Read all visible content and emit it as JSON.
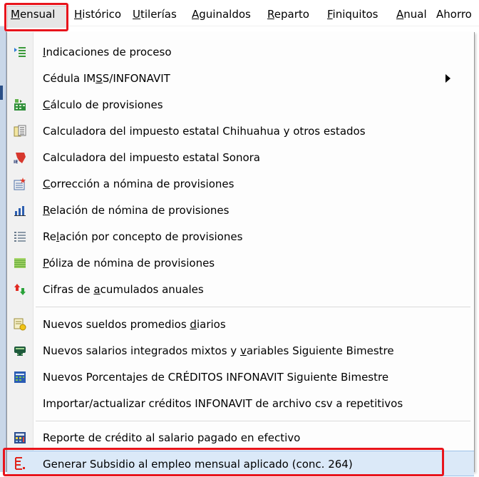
{
  "menubar": {
    "items": [
      {
        "pre": "",
        "u": "M",
        "post": "ensual"
      },
      {
        "pre": "",
        "u": "H",
        "post": "istórico"
      },
      {
        "pre": "",
        "u": "U",
        "post": "tilerías"
      },
      {
        "pre": "",
        "u": "A",
        "post": "guinaldos"
      },
      {
        "pre": "",
        "u": "R",
        "post": "eparto"
      },
      {
        "pre": "",
        "u": "F",
        "post": "iniquitos"
      },
      {
        "pre": "",
        "u": "A",
        "post": "nual"
      },
      {
        "pre": "Ahorro",
        "u": "",
        "post": ""
      }
    ]
  },
  "dropdown": {
    "items": [
      {
        "pre": "",
        "u": "I",
        "post": "ndicaciones de proceso",
        "icon": "process-indications-icon"
      },
      {
        "pre": "Cédula IM",
        "u": "S",
        "post": "S/INFONAVIT",
        "icon": "",
        "submenu": true
      },
      {
        "pre": "",
        "u": "C",
        "post": "álculo de provisiones",
        "icon": "calculate-provisions-icon"
      },
      {
        "pre": "Calculadora del impuesto estatal Chihuahua y otros estados",
        "u": "",
        "post": "",
        "icon": "state-tax-calculator-icon"
      },
      {
        "pre": "Calculadora del impuesto estatal Sonora",
        "u": "",
        "post": "",
        "icon": "sonora-tax-icon"
      },
      {
        "pre": "",
        "u": "C",
        "post": "orrección a nómina de provisiones",
        "icon": "payroll-correction-icon"
      },
      {
        "pre": "",
        "u": "R",
        "post": "elación de nómina de provisiones",
        "icon": "bar-chart-icon"
      },
      {
        "pre": "Re",
        "u": "l",
        "post": "ación por concepto de provisiones",
        "icon": "list-icon"
      },
      {
        "pre": "",
        "u": "P",
        "post": "óliza de nómina de provisiones",
        "icon": "policy-icon"
      },
      {
        "pre": "Cifras de ",
        "u": "a",
        "post": "cumulados anuales",
        "icon": "cumulative-figures-icon"
      },
      {
        "pre": "Nuevos sueldos promedios ",
        "u": "d",
        "post": "iarios",
        "icon": "salary-average-icon"
      },
      {
        "pre": "Nuevos salarios integrados mixtos y ",
        "u": "v",
        "post": "ariables Siguiente Bimestre",
        "icon": "integrated-salary-icon"
      },
      {
        "pre": "Nuevos Porcentajes de CRÉDITOS INFONAVIT Siguiente Bimestre",
        "u": "",
        "post": "",
        "icon": "infonavit-percent-icon"
      },
      {
        "pre": "Importar/actualizar créditos INFONAVIT de archivo csv a repetitivos",
        "u": "",
        "post": "",
        "icon": ""
      },
      {
        "pre": "Reporte de crédito al salario pagado en efectivo",
        "u": "",
        "post": "",
        "icon": "credit-report-icon"
      },
      {
        "pre": "Generar Subsidio al empleo mensual aplicado (conc. 264)",
        "u": "",
        "post": "",
        "icon": "generate-subsidy-icon"
      }
    ]
  }
}
